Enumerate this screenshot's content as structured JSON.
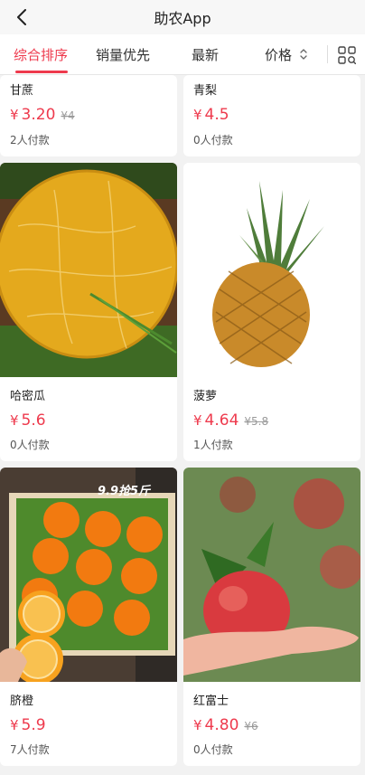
{
  "header": {
    "title": "助农App"
  },
  "tabs": [
    {
      "label": "综合排序"
    },
    {
      "label": "销量优先"
    },
    {
      "label": "最新"
    },
    {
      "label": "价格"
    }
  ],
  "products": [
    {
      "name": "甘蔗",
      "currency": "¥",
      "price": "3.20",
      "old_price": "¥4",
      "sold": "2人付款"
    },
    {
      "name": "青梨",
      "currency": "¥",
      "price": "4.5",
      "old_price": "",
      "sold": "0人付款"
    },
    {
      "name": "哈密瓜",
      "currency": "¥",
      "price": "5.6",
      "old_price": "",
      "sold": "0人付款"
    },
    {
      "name": "菠萝",
      "currency": "¥",
      "price": "4.64",
      "old_price": "¥5.8",
      "sold": "1人付款"
    },
    {
      "name": "脐橙",
      "currency": "¥",
      "price": "5.9",
      "old_price": "",
      "sold": "7人付款",
      "image_text": "9.9抢5斤"
    },
    {
      "name": "红富士",
      "currency": "¥",
      "price": "4.80",
      "old_price": "¥6",
      "sold": "0人付款"
    }
  ],
  "colors": {
    "accent": "#ee3a4d"
  }
}
